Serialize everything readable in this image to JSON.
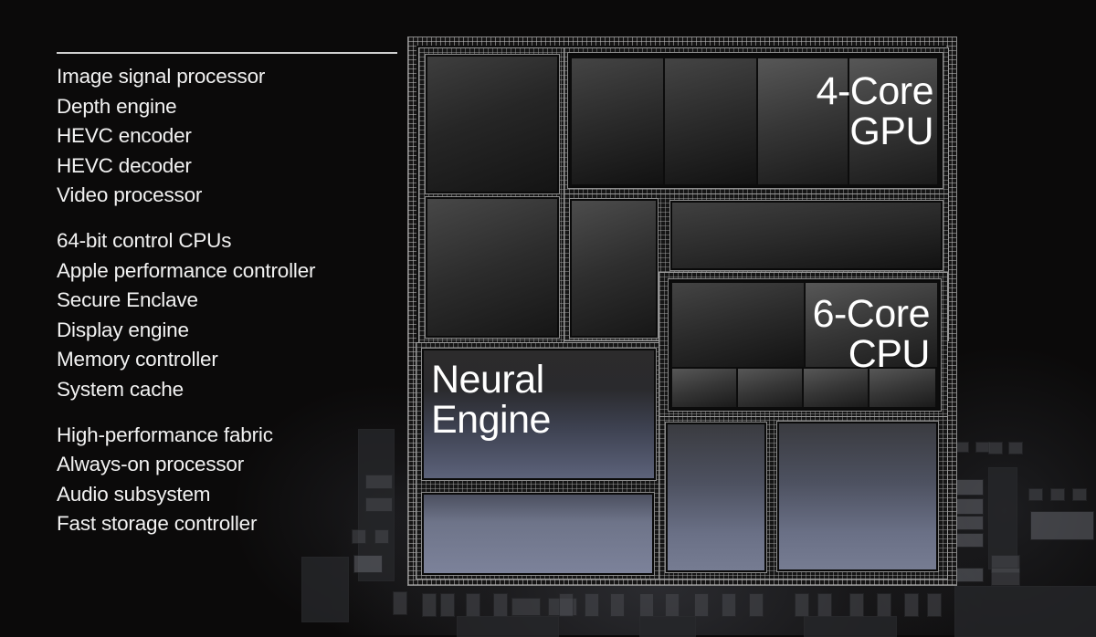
{
  "slide": {
    "feature_groups": [
      {
        "items": [
          "Image signal processor",
          "Depth engine",
          "HEVC encoder",
          "HEVC decoder",
          "Video processor"
        ]
      },
      {
        "items": [
          "64-bit control CPUs",
          "Apple performance controller",
          "Secure Enclave",
          "Display engine",
          "Memory controller",
          "System cache"
        ]
      },
      {
        "items": [
          "High-performance fabric",
          "Always-on processor",
          "Audio subsystem",
          "Fast storage controller"
        ]
      }
    ],
    "die_blocks": {
      "gpu": {
        "line1": "4-Core",
        "line2": "GPU"
      },
      "cpu": {
        "line1": "6-Core",
        "line2": "CPU"
      },
      "neural_engine": {
        "line1": "Neural",
        "line2": "Engine"
      }
    }
  }
}
